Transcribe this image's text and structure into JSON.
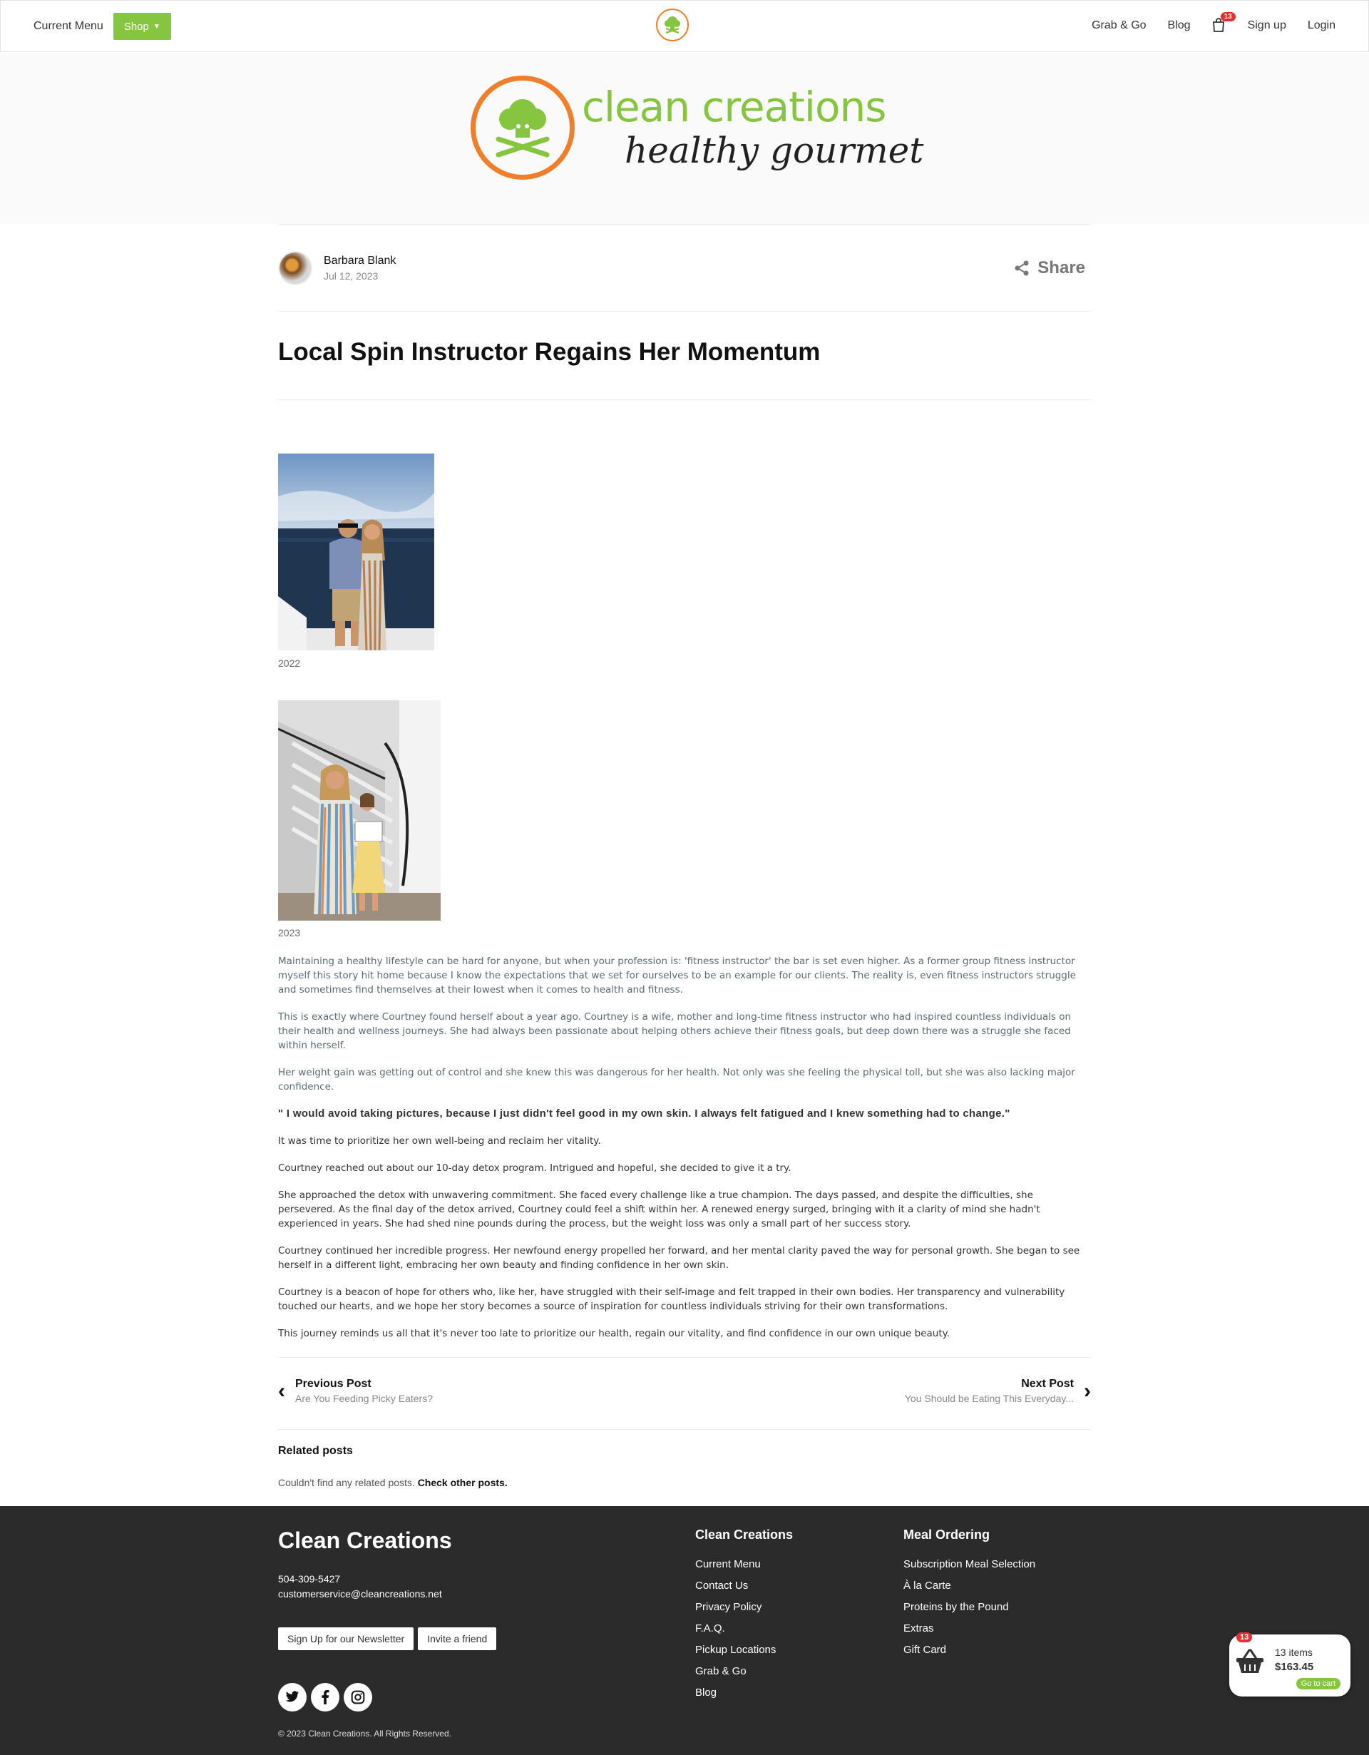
{
  "nav": {
    "current_menu": "Current Menu",
    "shop": "Shop",
    "grab_go": "Grab & Go",
    "blog": "Blog",
    "cart_count": "13",
    "signup": "Sign up",
    "login": "Login"
  },
  "brand": {
    "name": "clean creations",
    "tagline": "healthy gourmet",
    "green": "#86c540",
    "orange": "#f07f2c"
  },
  "post": {
    "author": "Barbara Blank",
    "date": "Jul 12, 2023",
    "share": "Share",
    "title": "Local Spin Instructor Regains Her Momentum",
    "caption_1": "2022",
    "caption_2": "2023",
    "paragraphs": [
      "Maintaining a healthy lifestyle can be hard for anyone, but when your profession is: 'fitness instructor' the bar is set even higher. As a former group fitness instructor myself this story hit home because I know the expectations that we set for ourselves to be an example for our clients. The reality is, even fitness instructors struggle and sometimes find themselves at their lowest when it comes to health and fitness.",
      "This is exactly where Courtney found herself about a year ago. Courtney is a wife, mother and long-time fitness instructor who had inspired countless individuals on their health and wellness journeys. She had always been passionate about helping others achieve their fitness goals, but deep down there was a struggle she faced within herself.",
      "Her weight gain was getting out of control and  she knew this was dangerous for her health. Not only was she feeling the physical toll, but she was also lacking major confidence.",
      " \" I would avoid taking pictures, because I just didn't feel good in my own skin. I always felt fatigued and I knew something had to change.\"",
      " It was time to prioritize her own well-being and reclaim her vitality.",
      "Courtney reached out about our 10-day detox program. Intrigued and hopeful, she decided to give it a try.",
      "She approached the detox with unwavering commitment. She faced every challenge like a true champion. The days passed, and despite the difficulties, she persevered. As the final day of the detox arrived, Courtney could feel a shift within her. A renewed energy surged, bringing with it a clarity of mind she hadn't experienced in years. She had shed nine pounds during the process, but the weight loss was only a small part of her success story.",
      "Courtney continued her incredible progress. Her newfound energy propelled her forward, and her mental clarity paved the way for personal growth. She began to see herself in a different light, embracing her own beauty and finding confidence in her own skin.",
      "Courtney is a beacon of hope for others who, like her, have struggled with their self-image and felt trapped in their own bodies. Her transparency and vulnerability touched our hearts, and we hope her story becomes a source of inspiration for countless individuals striving for their own transformations.",
      "This journey reminds us all that it's never too late to prioritize our health, regain our vitality, and find confidence in our own unique beauty."
    ],
    "prev_label": "Previous Post",
    "prev_title": "Are You Feeding Picky Eaters?",
    "next_label": "Next Post",
    "next_title": "You Should be Eating This Everyday...",
    "related_title": "Related posts",
    "related_text": "Couldn't find any related posts.",
    "related_link": "Check other posts."
  },
  "footer": {
    "brand": "Clean Creations",
    "phone": "504-309-5427",
    "email": "customerservice@cleancreations.net",
    "newsletter": "Sign Up for our Newsletter",
    "invite": "Invite a friend",
    "copyright": "© 2023 Clean Creations. All Rights Reserved.",
    "col1_title": "Clean Creations",
    "col1_links": [
      "Current Menu",
      "Contact Us",
      "Privacy Policy",
      "F.A.Q.",
      "Pickup Locations",
      "Grab & Go",
      "Blog"
    ],
    "col2_title": "Meal Ordering",
    "col2_links": [
      "Subscription Meal Selection",
      "À la Carte",
      "Proteins by the Pound",
      "Extras",
      "Gift Card"
    ]
  },
  "cart_widget": {
    "badge": "13",
    "items": "13 items",
    "total": "$163.45",
    "go": "Go to cart"
  }
}
